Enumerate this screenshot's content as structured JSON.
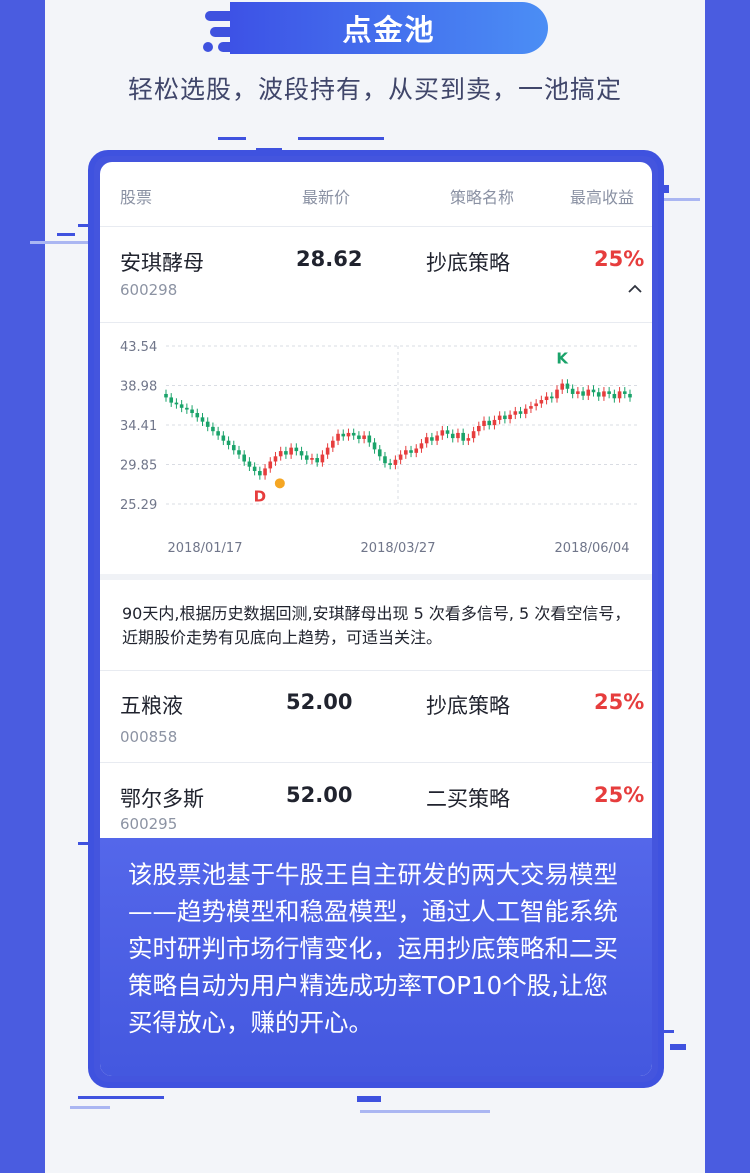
{
  "header": {
    "title": "点金池",
    "subtitle": "轻松选股，波段持有，从买到卖，一池搞定"
  },
  "table": {
    "columns": [
      "股票",
      "最新价",
      "策略名称",
      "最高收益"
    ],
    "expanded": {
      "name": "安琪酵母",
      "code": "600298",
      "price": "28.62",
      "strategy": "抄底策略",
      "gain": "25%"
    },
    "rows": [
      {
        "name": "五粮液",
        "code": "000858",
        "price": "52.00",
        "strategy": "抄底策略",
        "gain": "25%"
      },
      {
        "name": "鄂尔多斯",
        "code": "600295",
        "price": "52.00",
        "strategy": "二买策略",
        "gain": "25%"
      }
    ],
    "description": "90天内,根据历史数据回测,安琪酵母出现 5 次看多信号, 5 次看空信号，近期股价走势有见底向上趋势，可适当关注。"
  },
  "chart_data": {
    "type": "candlestick",
    "y_ticks": [
      "43.54",
      "38.98",
      "34.41",
      "29.85",
      "25.29"
    ],
    "ylim": [
      25.29,
      43.54
    ],
    "x_ticks": [
      "2018/01/17",
      "2018/03/27",
      "2018/06/04"
    ],
    "markers": [
      {
        "label": "D",
        "meaning": "buy",
        "color": "#e63d3d"
      },
      {
        "label": "K",
        "meaning": "sell",
        "color": "#1aa36a"
      }
    ],
    "up_color": "#e63d3d",
    "down_color": "#1aa36a",
    "closes": [
      37.6,
      37.0,
      36.8,
      36.4,
      36.2,
      35.8,
      35.3,
      34.8,
      34.2,
      33.7,
      33.2,
      32.6,
      32.1,
      31.5,
      31.0,
      30.2,
      29.6,
      29.1,
      28.6,
      29.4,
      30.2,
      30.8,
      31.4,
      31.0,
      31.8,
      31.4,
      30.9,
      30.4,
      30.6,
      30.1,
      31.0,
      31.8,
      32.6,
      33.4,
      33.1,
      33.5,
      33.2,
      32.8,
      33.2,
      32.4,
      31.6,
      30.8,
      30.0,
      29.8,
      30.4,
      31.0,
      31.5,
      31.2,
      31.7,
      32.3,
      33.0,
      32.6,
      33.2,
      33.8,
      33.4,
      32.9,
      33.5,
      32.6,
      32.9,
      33.7,
      34.3,
      34.9,
      34.4,
      35.0,
      35.5,
      35.1,
      35.6,
      36.0,
      35.7,
      36.3,
      36.6,
      36.9,
      37.3,
      37.7,
      37.5,
      38.5,
      39.2,
      38.6,
      38.0,
      38.3,
      37.8,
      38.5,
      38.2,
      37.7,
      38.3,
      38.0,
      37.5,
      38.3,
      38.0,
      37.6
    ]
  },
  "info": {
    "text": "该股票池基于牛股王自主研发的两大交易模型——趋势模型和稳盈模型，通过人工智能系统实时研判市场行情变化，运用抄底策略和二买策略自动为用户精选成功率TOP10个股,让您买得放心，赚的开心。"
  },
  "icons": {
    "collapse": "chevron-up-icon",
    "plus": "plus-circle-icon"
  }
}
